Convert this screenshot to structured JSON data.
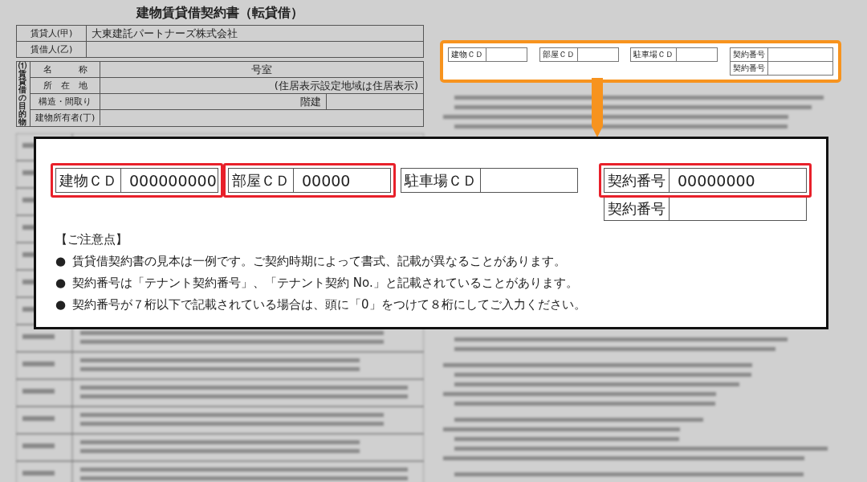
{
  "document": {
    "title": "建物賃貸借契約書（転貸借）",
    "parties": [
      {
        "label": "賃貸人(甲)",
        "value": "大東建託パートナーズ株式会社"
      },
      {
        "label": "賃借人(乙)"
      }
    ],
    "property": {
      "section_label": "⑴賃貸借の目的物",
      "rows": [
        {
          "kind": "center",
          "label": "名　　　称",
          "value": "号室"
        },
        {
          "kind": "note",
          "label": "所　在　地",
          "value": "(住居表示設定地域は住居表示)"
        },
        {
          "kind": "floors",
          "label": "構造・間取り",
          "value": "階建"
        },
        {
          "kind": "center",
          "label": "建物所有者(丁)"
        }
      ]
    }
  },
  "source_box": {
    "fields": [
      {
        "label": "建物ＣＤ"
      },
      {
        "label": "部屋ＣＤ"
      },
      {
        "label": "駐車場ＣＤ"
      },
      {
        "label": "契約番号"
      }
    ],
    "sub_field": {
      "label": "契約番号"
    }
  },
  "callout": {
    "fields": [
      {
        "label": "建物ＣＤ",
        "value": "000000000",
        "highlighted": true
      },
      {
        "label": "部屋ＣＤ",
        "value": "00000",
        "highlighted": true
      },
      {
        "label": "駐車場ＣＤ",
        "highlighted": false
      },
      {
        "label": "契約番号",
        "value": "00000000",
        "highlighted": true
      }
    ],
    "sub_field": {
      "label": "契約番号"
    },
    "notes_title": "【ご注意点】",
    "notes": [
      {
        "bullet": "●",
        "text": "賃貸借契約書の見本は一例です。ご契約時期によって書式、記載が異なることがあります。"
      },
      {
        "bullet": "●",
        "text": "契約番号は「テナント契約番号」、「テナント契約 No.」と記載されていることがあります。"
      },
      {
        "bullet": "●",
        "text": "契約番号が７桁以下で記載されている場合は、頭に「0」をつけて８桁にしてご入力ください。"
      }
    ]
  }
}
